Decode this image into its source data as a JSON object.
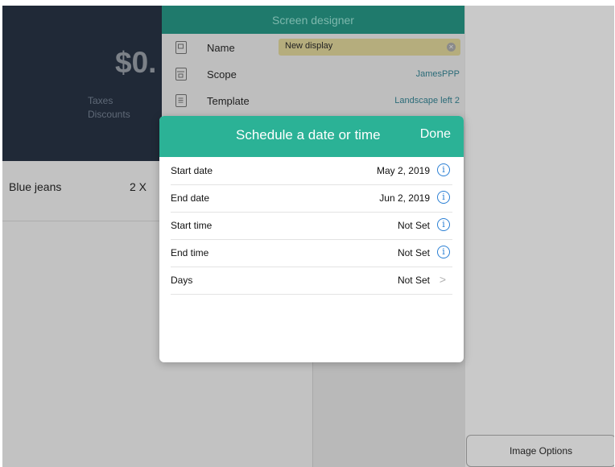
{
  "cart": {
    "total": "$0.",
    "taxes_label": "Taxes",
    "discounts_label": "Discounts",
    "items": [
      {
        "name": "Blue jeans",
        "qty": "2 X"
      }
    ]
  },
  "designer": {
    "title": "Screen designer",
    "fields": {
      "name": {
        "label": "Name",
        "value": "New display",
        "icon": "display-icon"
      },
      "scope": {
        "label": "Scope",
        "value": "JamesPPP",
        "icon": "store-icon"
      },
      "template": {
        "label": "Template",
        "value": "Landscape left 2",
        "icon": "document-icon"
      }
    }
  },
  "schedule": {
    "title": "Schedule a date or time",
    "done_label": "Done",
    "rows": [
      {
        "label": "Start date",
        "value": "May 2, 2019",
        "icon": "info-icon"
      },
      {
        "label": "End date",
        "value": "Jun 2, 2019",
        "icon": "info-icon"
      },
      {
        "label": "Start time",
        "value": "Not Set",
        "icon": "info-icon"
      },
      {
        "label": "End time",
        "value": "Not Set",
        "icon": "info-icon"
      },
      {
        "label": "Days",
        "value": "Not Set",
        "icon": "chevron-right-icon"
      }
    ]
  },
  "image_options": {
    "label": "Image Options"
  },
  "colors": {
    "accent": "#2bb296",
    "header_dim": "#1f7a6c",
    "panel_dark": "#202937",
    "link": "#2a7fd4"
  }
}
